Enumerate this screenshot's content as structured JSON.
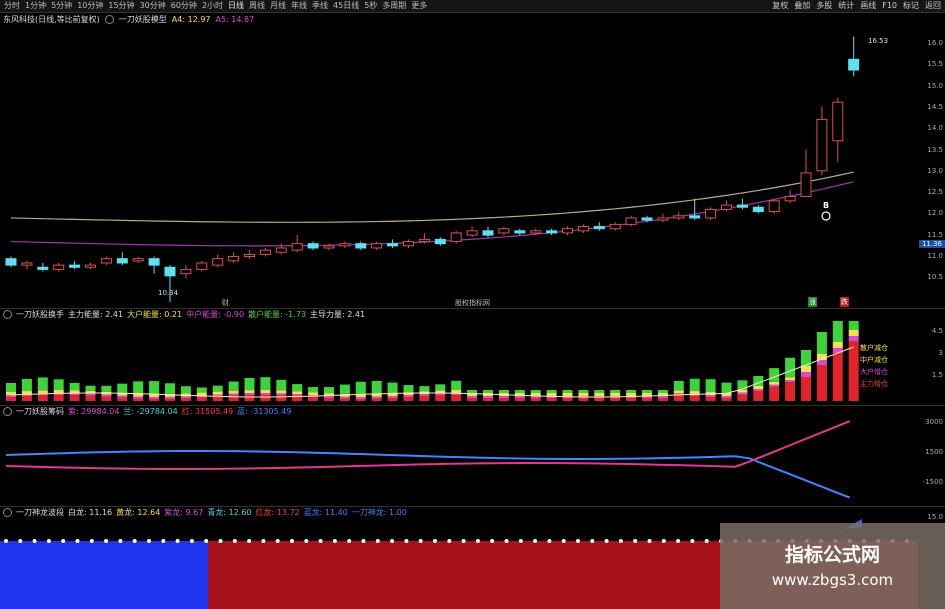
{
  "toolbar": {
    "periods": [
      "分时",
      "1分钟",
      "5分钟",
      "10分钟",
      "15分钟",
      "30分钟",
      "60分钟",
      "2小时",
      "日线",
      "周线",
      "月线",
      "年线",
      "季线",
      "45日线",
      "5秒",
      "多周期",
      "更多"
    ],
    "active_period": "日线",
    "tools": [
      "复权",
      "叠加",
      "多股",
      "统计",
      "画线",
      "F10",
      "标记",
      "返回"
    ]
  },
  "main": {
    "stock_title": "东风科技(日线,等比前复权)",
    "indicator_name": "一刀妖股模型",
    "a4_label": "A4: 12.97",
    "a5_label": "A5: 14.87",
    "price_high_label": "16.53",
    "price_low_label": "10.34",
    "current_price_tag": "11.36",
    "buy_marker": "B",
    "bottom_markers": [
      "财",
      "股权指标网",
      "涨",
      "跌"
    ],
    "axis_ticks": [
      "16.0",
      "15.5",
      "15.0",
      "14.5",
      "14.0",
      "13.5",
      "13.0",
      "12.5",
      "12.0",
      "11.5",
      "11.0",
      "10.5"
    ]
  },
  "panel1": {
    "name": "一刀妖股换手",
    "items": [
      {
        "label": "主力能量: 2.41",
        "color": "#dddddd"
      },
      {
        "label": "大户能量: 0.21",
        "color": "#f3e04a"
      },
      {
        "label": "中户能量: -0.90",
        "color": "#d84ad0"
      },
      {
        "label": "散户能量: -1.73",
        "color": "#52d04f"
      },
      {
        "label": "主导力量: 2.41",
        "color": "#dddddd"
      }
    ],
    "bar_tags": [
      "散户减仓",
      "中户减仓",
      "大户增仓",
      "主力增仓"
    ],
    "axis_ticks": [
      "4.5",
      "3",
      "1.5"
    ]
  },
  "panel2": {
    "name": "一刀妖股筹码",
    "items": [
      {
        "label": "紫: 29984.04",
        "color": "#d84ad0"
      },
      {
        "label": "兰: -29784.04",
        "color": "#47d3e6"
      },
      {
        "label": "红: 31505.49",
        "color": "#ff3c3c"
      },
      {
        "label": "蓝: -31305.49",
        "color": "#4f7cff"
      }
    ],
    "axis_ticks": [
      "3000",
      "1500",
      "-1500"
    ]
  },
  "panel3": {
    "name": "一刀神龙波段",
    "items": [
      {
        "label": "白龙: 11.16",
        "color": "#dddddd"
      },
      {
        "label": "黄龙: 12.64",
        "color": "#f3e04a"
      },
      {
        "label": "紫龙: 9.67",
        "color": "#d84ad0"
      },
      {
        "label": "青龙: 12.60",
        "color": "#47d3e6"
      },
      {
        "label": "红龙: 13.72",
        "color": "#ff3c3c"
      },
      {
        "label": "蓝龙: 11.40",
        "color": "#4f7cff"
      },
      {
        "label": "一刀神龙: 1.00",
        "color": "#4f7cff"
      }
    ],
    "axis_ticks": [
      "15.0"
    ]
  },
  "watermark": {
    "line1": "指标公式网",
    "line2": "www.zbgs3.com"
  },
  "candles": [
    [
      11.35,
      11.2,
      11.4,
      11.15
    ],
    [
      11.2,
      11.25,
      11.3,
      11.1
    ],
    [
      11.15,
      11.1,
      11.25,
      11.05
    ],
    [
      11.1,
      11.2,
      11.25,
      11.05
    ],
    [
      11.2,
      11.15,
      11.3,
      11.1
    ],
    [
      11.15,
      11.2,
      11.25,
      11.1
    ],
    [
      11.25,
      11.35,
      11.4,
      11.2
    ],
    [
      11.35,
      11.25,
      11.5,
      11.2
    ],
    [
      11.3,
      11.35,
      11.4,
      11.25
    ],
    [
      11.35,
      11.2,
      11.4,
      11.0
    ],
    [
      11.15,
      10.95,
      11.2,
      10.34
    ],
    [
      11.0,
      11.1,
      11.2,
      10.9
    ],
    [
      11.1,
      11.25,
      11.3,
      11.05
    ],
    [
      11.2,
      11.35,
      11.45,
      11.15
    ],
    [
      11.3,
      11.4,
      11.5,
      11.25
    ],
    [
      11.4,
      11.45,
      11.55,
      11.35
    ],
    [
      11.45,
      11.55,
      11.6,
      11.4
    ],
    [
      11.5,
      11.6,
      11.7,
      11.45
    ],
    [
      11.55,
      11.7,
      11.9,
      11.5
    ],
    [
      11.7,
      11.6,
      11.75,
      11.55
    ],
    [
      11.6,
      11.65,
      11.7,
      11.55
    ],
    [
      11.65,
      11.7,
      11.75,
      11.6
    ],
    [
      11.7,
      11.6,
      11.75,
      11.55
    ],
    [
      11.6,
      11.7,
      11.75,
      11.55
    ],
    [
      11.7,
      11.65,
      11.8,
      11.6
    ],
    [
      11.65,
      11.75,
      11.8,
      11.6
    ],
    [
      11.75,
      11.8,
      11.95,
      11.7
    ],
    [
      11.8,
      11.7,
      11.85,
      11.65
    ],
    [
      11.75,
      11.95,
      12.0,
      11.7
    ],
    [
      11.9,
      12.0,
      12.1,
      11.85
    ],
    [
      12.0,
      11.9,
      12.1,
      11.85
    ],
    [
      11.95,
      12.05,
      12.1,
      11.9
    ],
    [
      12.0,
      11.95,
      12.05,
      11.9
    ],
    [
      11.95,
      12.0,
      12.05,
      11.9
    ],
    [
      12.0,
      11.95,
      12.05,
      11.9
    ],
    [
      11.95,
      12.05,
      12.1,
      11.9
    ],
    [
      12.0,
      12.1,
      12.15,
      11.95
    ],
    [
      12.1,
      12.05,
      12.2,
      12.0
    ],
    [
      12.05,
      12.15,
      12.2,
      12.0
    ],
    [
      12.15,
      12.3,
      12.35,
      12.1
    ],
    [
      12.3,
      12.25,
      12.35,
      12.2
    ],
    [
      12.25,
      12.3,
      12.4,
      12.2
    ],
    [
      12.3,
      12.35,
      12.45,
      12.25
    ],
    [
      12.35,
      12.3,
      12.75,
      12.25
    ],
    [
      12.3,
      12.5,
      12.55,
      12.25
    ],
    [
      12.5,
      12.6,
      12.7,
      12.45
    ],
    [
      12.6,
      12.55,
      12.75,
      12.5
    ],
    [
      12.55,
      12.45,
      12.6,
      12.4
    ],
    [
      12.45,
      12.7,
      12.75,
      12.4
    ],
    [
      12.7,
      12.8,
      12.95,
      12.65
    ],
    [
      12.8,
      13.35,
      13.9,
      12.8
    ],
    [
      13.4,
      14.6,
      14.9,
      13.3
    ],
    [
      14.1,
      15.0,
      15.1,
      13.6
    ],
    [
      16.0,
      15.75,
      16.53,
      15.6
    ]
  ]
}
